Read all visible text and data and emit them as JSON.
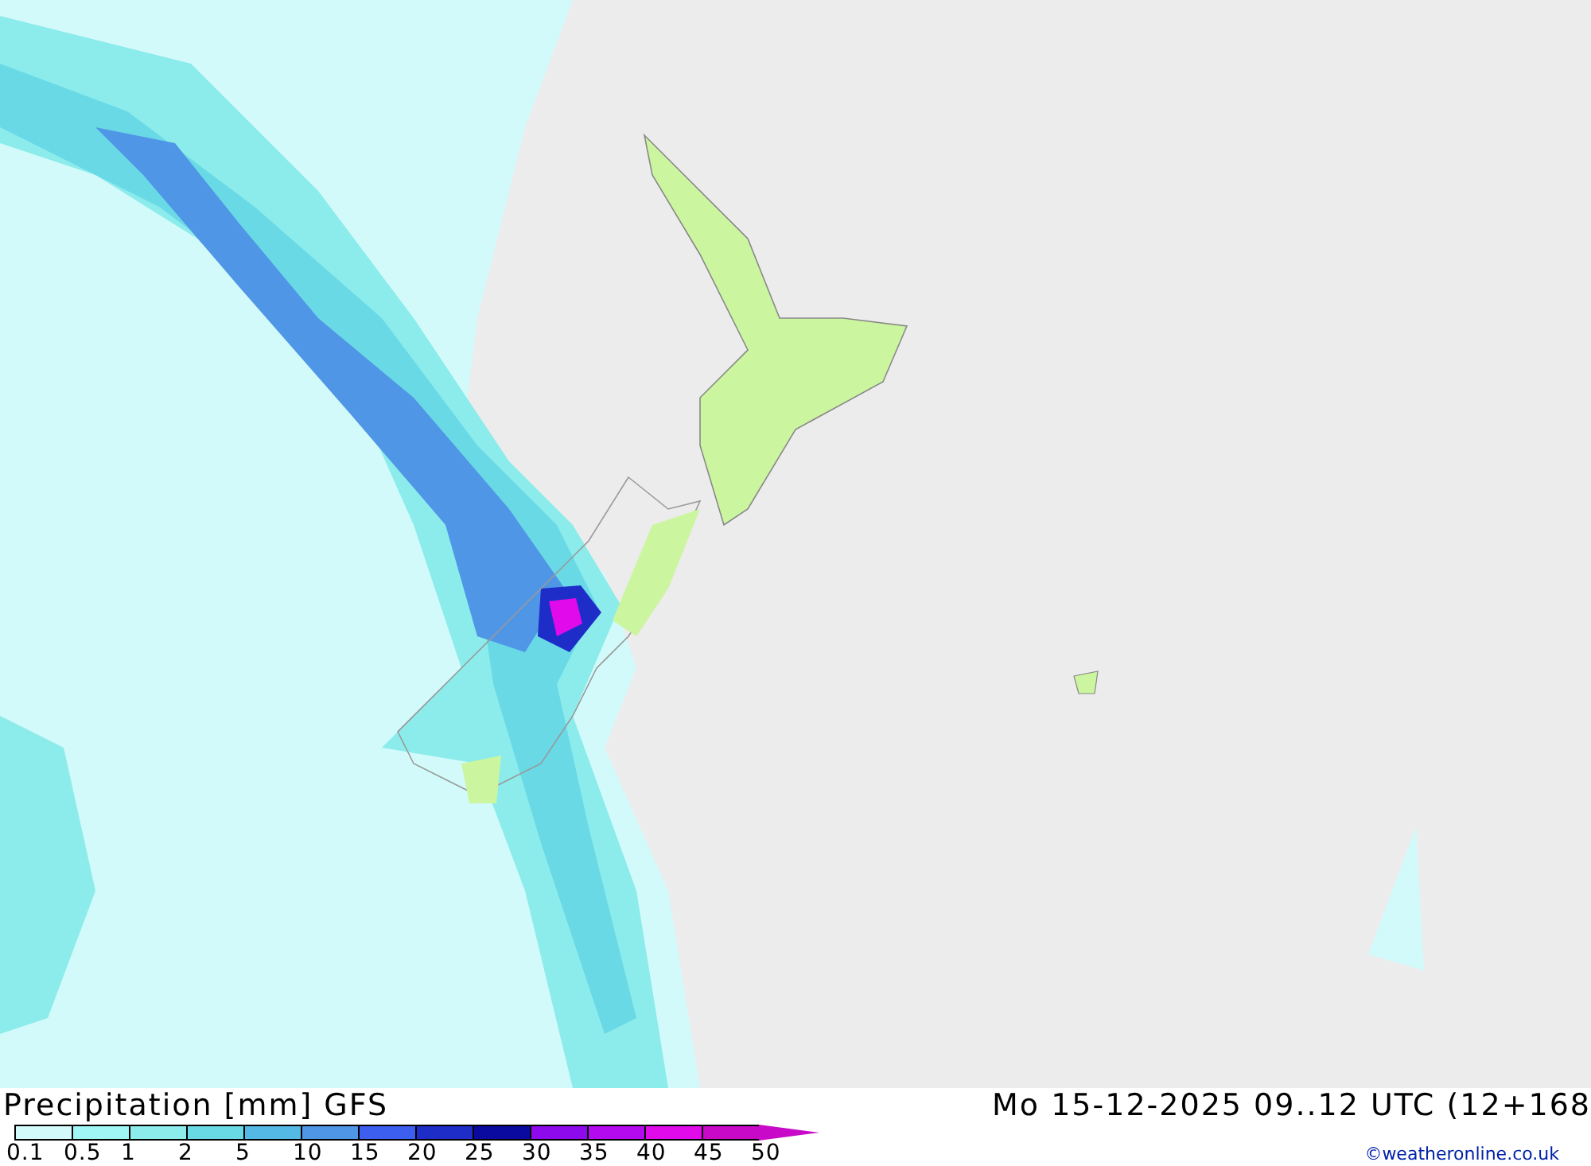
{
  "title": "Precipitation [mm] GFS",
  "valid_time": "Mo 15-12-2025 09..12 UTC (12+168",
  "legend": {
    "bins": [
      {
        "color": "#d2fafa"
      },
      {
        "color": "#a0f5f5"
      },
      {
        "color": "#8ceceb"
      },
      {
        "color": "#6ad9e6"
      },
      {
        "color": "#55b9e6"
      },
      {
        "color": "#5096e6"
      },
      {
        "color": "#3c5ff0"
      },
      {
        "color": "#1e2dc8"
      },
      {
        "color": "#0a0aa0"
      },
      {
        "color": "#8c0aeb"
      },
      {
        "color": "#b40af0"
      },
      {
        "color": "#e10aeb"
      },
      {
        "color": "#c80ac8"
      }
    ],
    "labels": [
      "0.1",
      "0.5",
      "1",
      "2",
      "5",
      "10",
      "15",
      "20",
      "25",
      "30",
      "35",
      "40",
      "45",
      "50"
    ]
  },
  "credit": "©weatheronline.co.uk"
}
